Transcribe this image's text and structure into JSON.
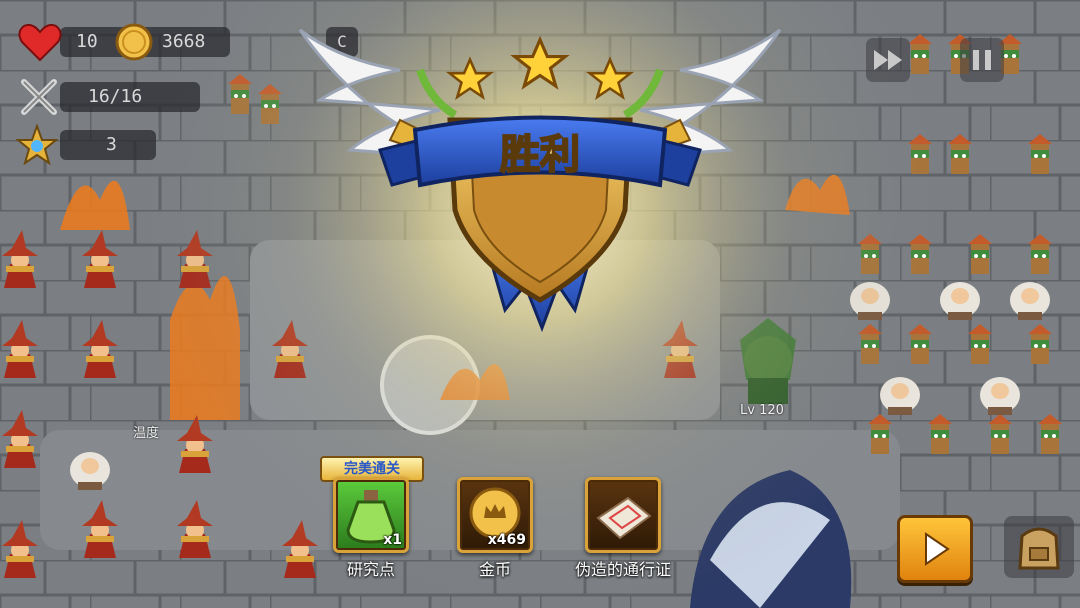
{
  "hud": {
    "lives": "10",
    "gold": "3668",
    "wave": "16/16",
    "stars": "3",
    "speed_label": "C"
  },
  "victory": {
    "title": "胜利",
    "stars_earned": 3
  },
  "perfect_badge": "完美通关",
  "rewards": [
    {
      "name": "研究点",
      "qty": "x1",
      "icon": "green-potion-icon"
    },
    {
      "name": "金币",
      "qty": "x469",
      "icon": "gold-coin-icon"
    },
    {
      "name": "伪造的通行证",
      "qty": "",
      "icon": "forged-pass-icon"
    }
  ],
  "battlefield": {
    "hero_level": "Lv 120",
    "unit_label": "温度"
  },
  "colors": {
    "banner_blue": "#2a59c7",
    "gold": "#e7b43b",
    "button_orange": "#f0a21a"
  }
}
